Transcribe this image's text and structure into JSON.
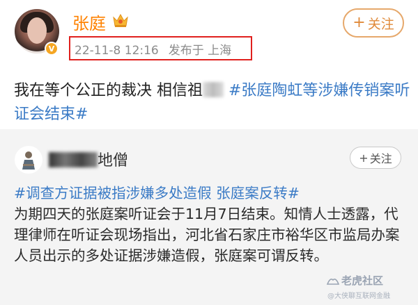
{
  "post": {
    "username": "张庭",
    "timestamp": "22-11-8 12:16",
    "source": "发布于 上海",
    "follow_label": "关注",
    "text_part1": "我在等个公正的裁决 相信祖",
    "topic": "#张庭陶虹等涉嫌传销案听证会结束#",
    "verified_badge": "V"
  },
  "repost": {
    "name_visible": "地僧",
    "follow_label": "关注",
    "topic": "#调查方证据被指涉嫌多处造假 张庭案反转#",
    "body": "为期四天的张庭案听证会于11月7日结束。知情人士透露，代理律师在听证会现场指出，河北省石家庄市裕华区市监局办案人员出示的多处证据涉嫌造假，张庭案可谓反转。"
  },
  "watermark": {
    "main": "老虎社区",
    "sub": "@大侠聊互联网金融"
  },
  "colors": {
    "accent_orange": "#ff8200",
    "topic_blue": "#3b7bc6",
    "highlight_red": "#e0201d"
  }
}
